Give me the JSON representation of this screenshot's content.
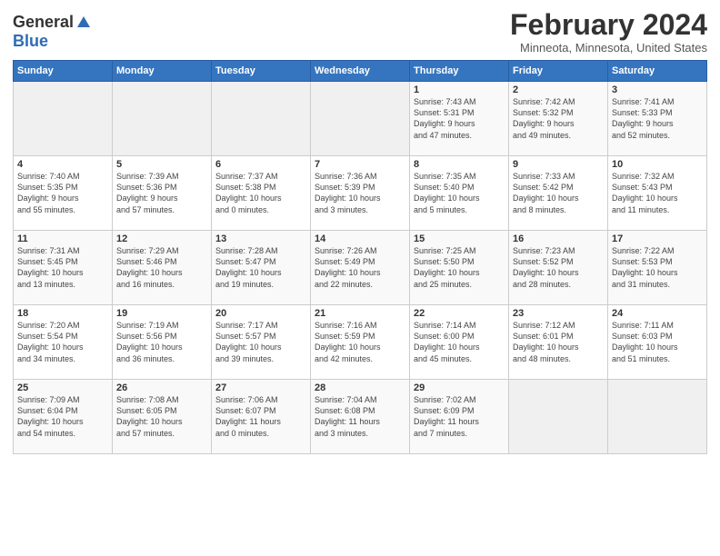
{
  "header": {
    "logo_line1": "General",
    "logo_line2": "Blue",
    "title": "February 2024",
    "subtitle": "Minneota, Minnesota, United States"
  },
  "days_of_week": [
    "Sunday",
    "Monday",
    "Tuesday",
    "Wednesday",
    "Thursday",
    "Friday",
    "Saturday"
  ],
  "weeks": [
    [
      {
        "day": "",
        "info": ""
      },
      {
        "day": "",
        "info": ""
      },
      {
        "day": "",
        "info": ""
      },
      {
        "day": "",
        "info": ""
      },
      {
        "day": "1",
        "info": "Sunrise: 7:43 AM\nSunset: 5:31 PM\nDaylight: 9 hours\nand 47 minutes."
      },
      {
        "day": "2",
        "info": "Sunrise: 7:42 AM\nSunset: 5:32 PM\nDaylight: 9 hours\nand 49 minutes."
      },
      {
        "day": "3",
        "info": "Sunrise: 7:41 AM\nSunset: 5:33 PM\nDaylight: 9 hours\nand 52 minutes."
      }
    ],
    [
      {
        "day": "4",
        "info": "Sunrise: 7:40 AM\nSunset: 5:35 PM\nDaylight: 9 hours\nand 55 minutes."
      },
      {
        "day": "5",
        "info": "Sunrise: 7:39 AM\nSunset: 5:36 PM\nDaylight: 9 hours\nand 57 minutes."
      },
      {
        "day": "6",
        "info": "Sunrise: 7:37 AM\nSunset: 5:38 PM\nDaylight: 10 hours\nand 0 minutes."
      },
      {
        "day": "7",
        "info": "Sunrise: 7:36 AM\nSunset: 5:39 PM\nDaylight: 10 hours\nand 3 minutes."
      },
      {
        "day": "8",
        "info": "Sunrise: 7:35 AM\nSunset: 5:40 PM\nDaylight: 10 hours\nand 5 minutes."
      },
      {
        "day": "9",
        "info": "Sunrise: 7:33 AM\nSunset: 5:42 PM\nDaylight: 10 hours\nand 8 minutes."
      },
      {
        "day": "10",
        "info": "Sunrise: 7:32 AM\nSunset: 5:43 PM\nDaylight: 10 hours\nand 11 minutes."
      }
    ],
    [
      {
        "day": "11",
        "info": "Sunrise: 7:31 AM\nSunset: 5:45 PM\nDaylight: 10 hours\nand 13 minutes."
      },
      {
        "day": "12",
        "info": "Sunrise: 7:29 AM\nSunset: 5:46 PM\nDaylight: 10 hours\nand 16 minutes."
      },
      {
        "day": "13",
        "info": "Sunrise: 7:28 AM\nSunset: 5:47 PM\nDaylight: 10 hours\nand 19 minutes."
      },
      {
        "day": "14",
        "info": "Sunrise: 7:26 AM\nSunset: 5:49 PM\nDaylight: 10 hours\nand 22 minutes."
      },
      {
        "day": "15",
        "info": "Sunrise: 7:25 AM\nSunset: 5:50 PM\nDaylight: 10 hours\nand 25 minutes."
      },
      {
        "day": "16",
        "info": "Sunrise: 7:23 AM\nSunset: 5:52 PM\nDaylight: 10 hours\nand 28 minutes."
      },
      {
        "day": "17",
        "info": "Sunrise: 7:22 AM\nSunset: 5:53 PM\nDaylight: 10 hours\nand 31 minutes."
      }
    ],
    [
      {
        "day": "18",
        "info": "Sunrise: 7:20 AM\nSunset: 5:54 PM\nDaylight: 10 hours\nand 34 minutes."
      },
      {
        "day": "19",
        "info": "Sunrise: 7:19 AM\nSunset: 5:56 PM\nDaylight: 10 hours\nand 36 minutes."
      },
      {
        "day": "20",
        "info": "Sunrise: 7:17 AM\nSunset: 5:57 PM\nDaylight: 10 hours\nand 39 minutes."
      },
      {
        "day": "21",
        "info": "Sunrise: 7:16 AM\nSunset: 5:59 PM\nDaylight: 10 hours\nand 42 minutes."
      },
      {
        "day": "22",
        "info": "Sunrise: 7:14 AM\nSunset: 6:00 PM\nDaylight: 10 hours\nand 45 minutes."
      },
      {
        "day": "23",
        "info": "Sunrise: 7:12 AM\nSunset: 6:01 PM\nDaylight: 10 hours\nand 48 minutes."
      },
      {
        "day": "24",
        "info": "Sunrise: 7:11 AM\nSunset: 6:03 PM\nDaylight: 10 hours\nand 51 minutes."
      }
    ],
    [
      {
        "day": "25",
        "info": "Sunrise: 7:09 AM\nSunset: 6:04 PM\nDaylight: 10 hours\nand 54 minutes."
      },
      {
        "day": "26",
        "info": "Sunrise: 7:08 AM\nSunset: 6:05 PM\nDaylight: 10 hours\nand 57 minutes."
      },
      {
        "day": "27",
        "info": "Sunrise: 7:06 AM\nSunset: 6:07 PM\nDaylight: 11 hours\nand 0 minutes."
      },
      {
        "day": "28",
        "info": "Sunrise: 7:04 AM\nSunset: 6:08 PM\nDaylight: 11 hours\nand 3 minutes."
      },
      {
        "day": "29",
        "info": "Sunrise: 7:02 AM\nSunset: 6:09 PM\nDaylight: 11 hours\nand 7 minutes."
      },
      {
        "day": "",
        "info": ""
      },
      {
        "day": "",
        "info": ""
      }
    ]
  ]
}
